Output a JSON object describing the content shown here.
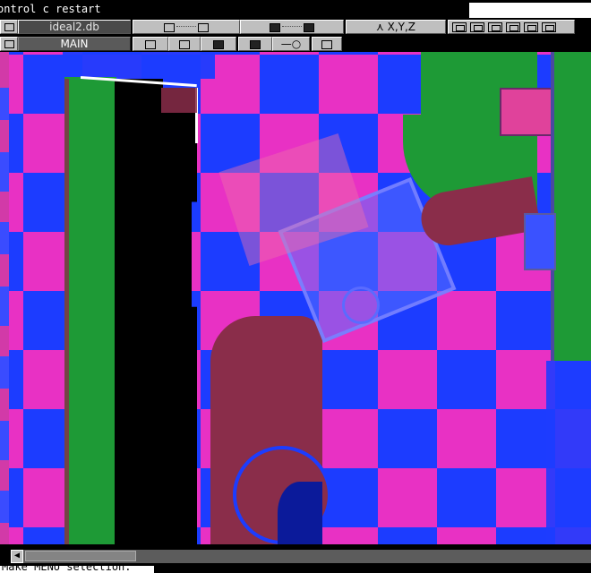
{
  "window": {
    "title": "ontrol c restart"
  },
  "toolbar": {
    "db_name": "ideal2.db",
    "mode_label": "MAIN",
    "axis_label": "X,Y,Z",
    "view_buttons": [
      "layout-1-icon",
      "layout-2-icon",
      "layout-3-icon",
      "layout-4-icon",
      "layout-5-icon",
      "layout-6-icon"
    ]
  },
  "status": {
    "message": "Make  MENU selection."
  },
  "colors": {
    "checker_pink": "#e831c4",
    "checker_blue": "#1c3cff",
    "model_green": "#1e9a36",
    "model_black": "#000000",
    "model_maroon": "#8a2d4a"
  }
}
